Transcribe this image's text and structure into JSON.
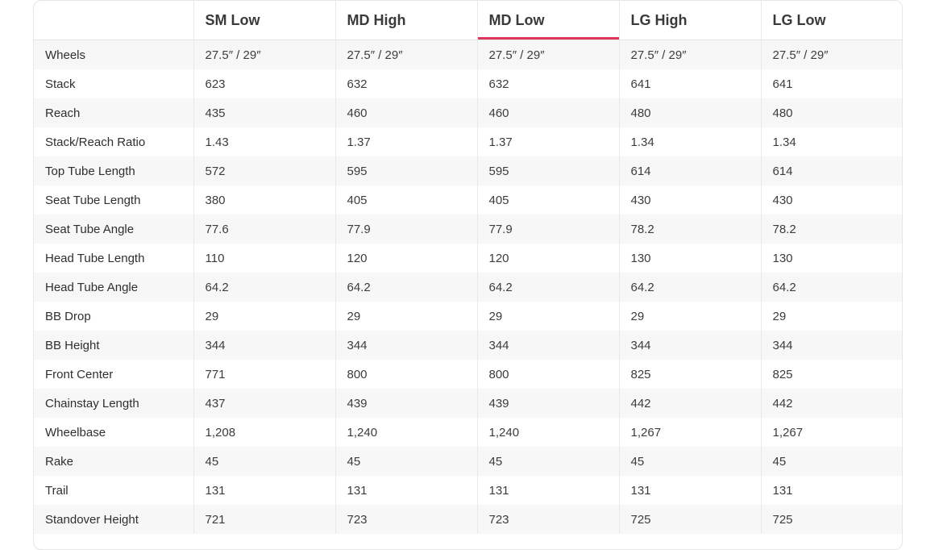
{
  "table": {
    "columns": [
      "",
      "SM Low",
      "MD High",
      "MD Low",
      "LG High",
      "LG Low"
    ],
    "active_column_index": 3,
    "accent_color": "#e0355e",
    "rows": [
      {
        "label": "Wheels",
        "values": [
          "27.5″ / 29″",
          "27.5″ / 29″",
          "27.5″ / 29″",
          "27.5″ / 29″",
          "27.5″ / 29″"
        ]
      },
      {
        "label": "Stack",
        "values": [
          "623",
          "632",
          "632",
          "641",
          "641"
        ]
      },
      {
        "label": "Reach",
        "values": [
          "435",
          "460",
          "460",
          "480",
          "480"
        ]
      },
      {
        "label": "Stack/Reach Ratio",
        "values": [
          "1.43",
          "1.37",
          "1.37",
          "1.34",
          "1.34"
        ]
      },
      {
        "label": "Top Tube Length",
        "values": [
          "572",
          "595",
          "595",
          "614",
          "614"
        ]
      },
      {
        "label": "Seat Tube Length",
        "values": [
          "380",
          "405",
          "405",
          "430",
          "430"
        ]
      },
      {
        "label": "Seat Tube Angle",
        "values": [
          "77.6",
          "77.9",
          "77.9",
          "78.2",
          "78.2"
        ]
      },
      {
        "label": "Head Tube Length",
        "values": [
          "110",
          "120",
          "120",
          "130",
          "130"
        ]
      },
      {
        "label": "Head Tube Angle",
        "values": [
          "64.2",
          "64.2",
          "64.2",
          "64.2",
          "64.2"
        ]
      },
      {
        "label": "BB Drop",
        "values": [
          "29",
          "29",
          "29",
          "29",
          "29"
        ]
      },
      {
        "label": "BB Height",
        "values": [
          "344",
          "344",
          "344",
          "344",
          "344"
        ]
      },
      {
        "label": "Front Center",
        "values": [
          "771",
          "800",
          "800",
          "825",
          "825"
        ]
      },
      {
        "label": "Chainstay Length",
        "values": [
          "437",
          "439",
          "439",
          "442",
          "442"
        ]
      },
      {
        "label": "Wheelbase",
        "values": [
          "1,208",
          "1,240",
          "1,240",
          "1,267",
          "1,267"
        ]
      },
      {
        "label": "Rake",
        "values": [
          "45",
          "45",
          "45",
          "45",
          "45"
        ]
      },
      {
        "label": "Trail",
        "values": [
          "131",
          "131",
          "131",
          "131",
          "131"
        ]
      },
      {
        "label": "Standover Height",
        "values": [
          "721",
          "723",
          "723",
          "725",
          "725"
        ]
      }
    ]
  }
}
